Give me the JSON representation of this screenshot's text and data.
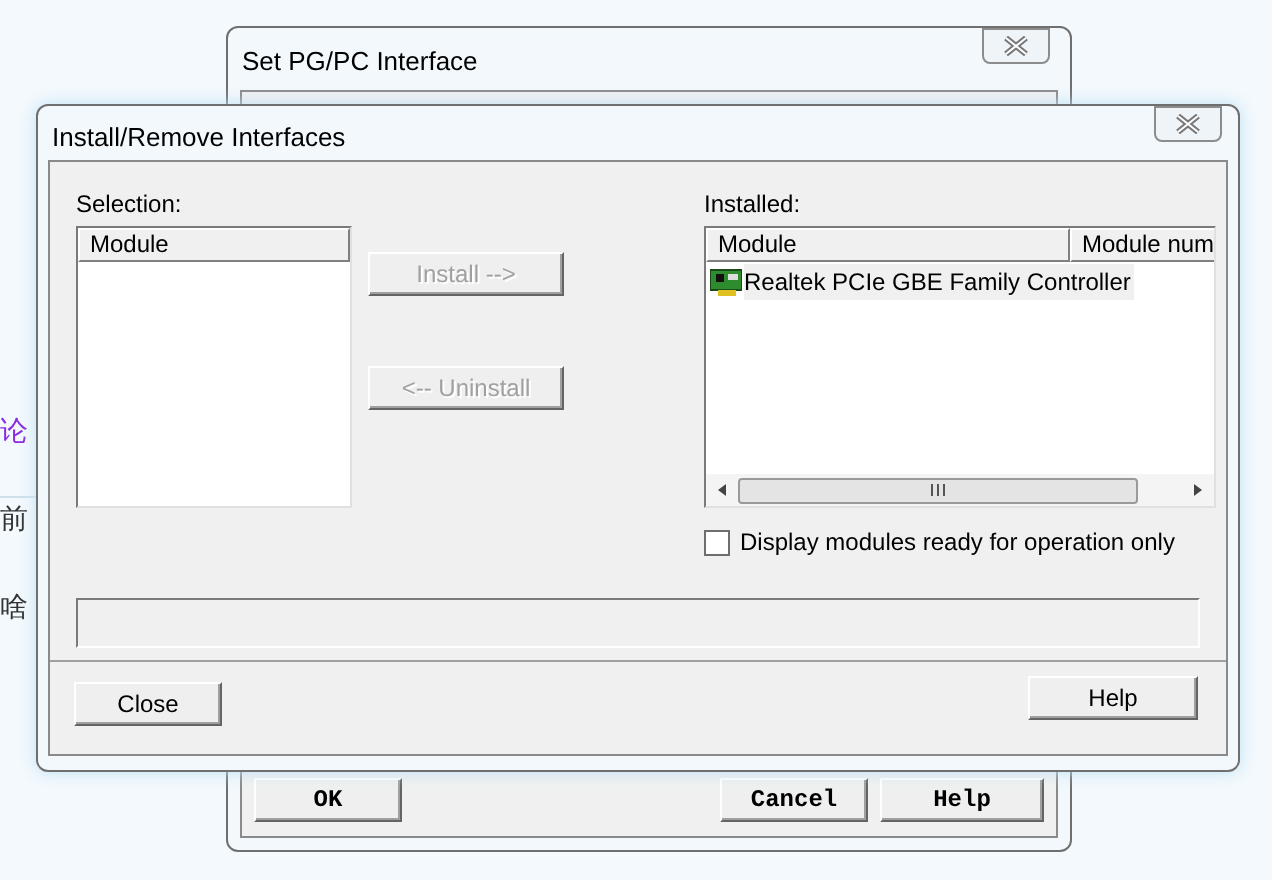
{
  "background_page": {
    "texts": [
      {
        "text": "论",
        "kind": "link"
      },
      {
        "text": "前",
        "kind": "plain"
      },
      {
        "text": "啥",
        "kind": "plain"
      }
    ]
  },
  "back_window": {
    "title": "Set PG/PC Interface",
    "buttons": [
      {
        "label": "OK"
      },
      {
        "label": "Cancel"
      },
      {
        "label": "Help"
      }
    ]
  },
  "dialog": {
    "title": "Install/Remove Interfaces",
    "selection": {
      "label": "Selection:",
      "columns": [
        "Module"
      ]
    },
    "actions": [
      {
        "label": "Install -->",
        "disabled": true
      },
      {
        "label": "<-- Uninstall",
        "disabled": true
      }
    ],
    "installed": {
      "label": "Installed:",
      "columns": [
        "Module",
        "Module num"
      ],
      "rows": [
        {
          "module": "Realtek PCIe GBE Family Controller"
        }
      ]
    },
    "ready_only": {
      "label": "Display modules ready for operation only",
      "checked": false
    },
    "buttons": [
      {
        "label": "Close",
        "kind": "left"
      },
      {
        "label": "Help",
        "kind": "right"
      }
    ]
  }
}
